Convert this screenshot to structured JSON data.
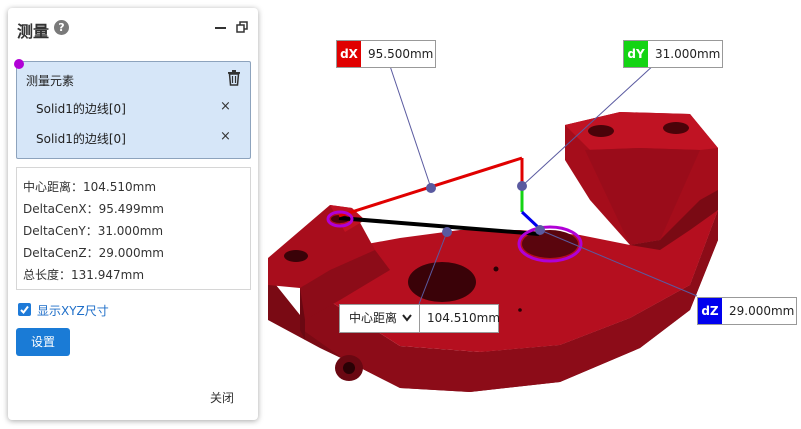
{
  "panel": {
    "title": "测量",
    "help_icon": "?",
    "icons": [
      "help-icon",
      "minimize-icon",
      "restore-icon",
      "trash-icon",
      "close-icon",
      "check-icon",
      "chevron-down-icon"
    ],
    "elements": {
      "title": "测量元素",
      "items": [
        {
          "label": "Solid1的边线[0]",
          "remove": "×"
        },
        {
          "label": "Solid1的边线[0]",
          "remove": "×"
        }
      ]
    },
    "info": [
      "中心距离：104.510mm",
      "DeltaCenX：95.499mm",
      "DeltaCenY：31.000mm",
      "DeltaCenZ：29.000mm",
      "总长度：131.947mm"
    ],
    "show_xyz": {
      "label": "显示XYZ尺寸",
      "checked": true
    },
    "settings_button": "设置",
    "close_button": "关闭"
  },
  "viewport": {
    "dx": {
      "key": "dX",
      "value": "95.500mm",
      "color": "#e00000"
    },
    "dy": {
      "key": "dY",
      "value": "31.000mm",
      "color": "#14d414"
    },
    "dz": {
      "key": "dZ",
      "value": "29.000mm",
      "color": "#0000ee"
    },
    "distance": {
      "mode": "中心距离",
      "value": "104.510mm"
    },
    "colors": {
      "part": "#b50f1f",
      "highlight": "#b000d6",
      "dimension_line": "#5a5aa0"
    }
  }
}
